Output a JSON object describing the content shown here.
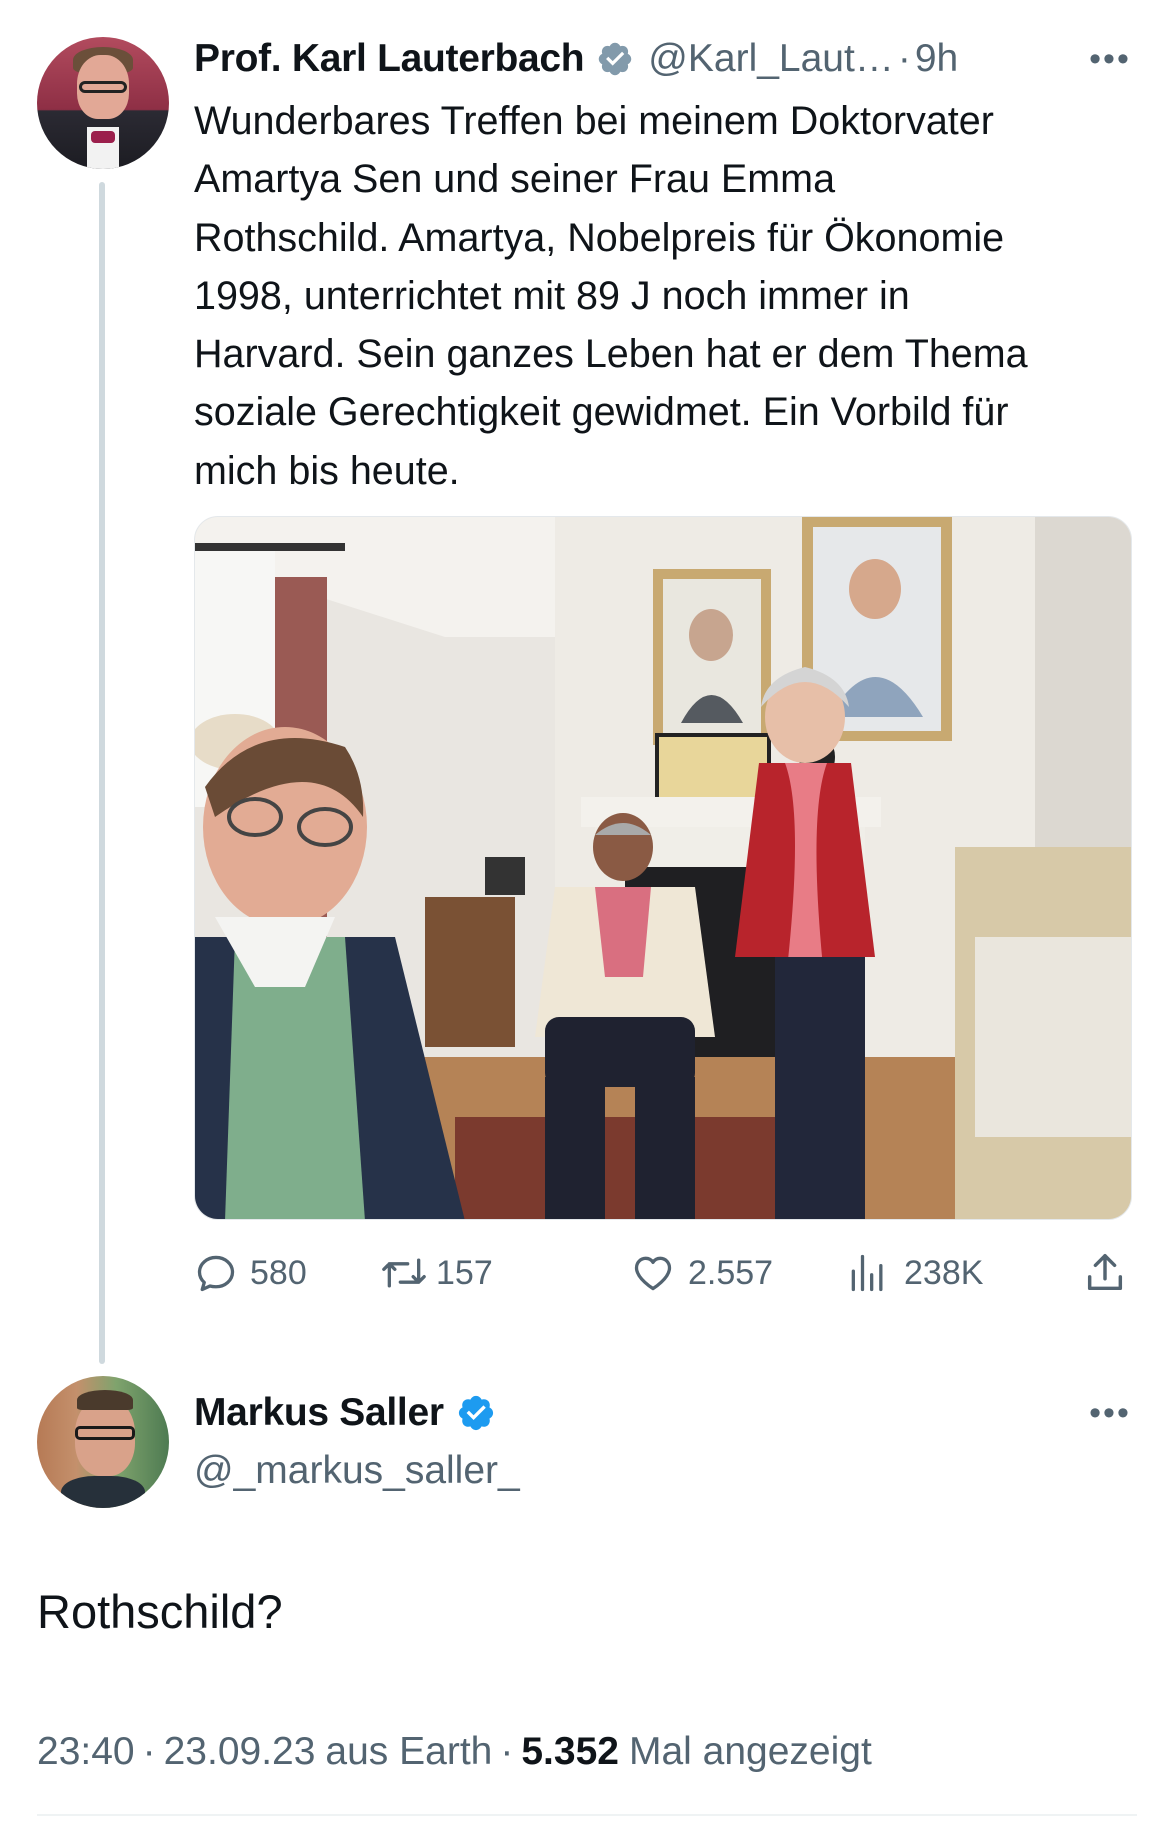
{
  "tweet": {
    "author_name": "Prof. Karl Lauterbach",
    "author_handle": "@Karl_Laut…",
    "time_separator": "·",
    "time_ago": "9h",
    "more_label": "•••",
    "text": "Wunderbares Treffen bei meinem Doktorvater\nAmartya Sen und seiner Frau Emma\nRothschild. Amartya, Nobelpreis für Ökonomie\n1998, unterrichtet mit 89 J noch immer in\nHarvard. Sein ganzes Leben hat er dem Thema\nsoziale Gerechtigkeit gewidmet. Ein Vorbild für\nmich bis heute.",
    "actions": {
      "replies": "580",
      "retweets": "157",
      "likes": "2.557",
      "views": "238K"
    }
  },
  "reply": {
    "author_name": "Markus Saller",
    "author_handle": "@_markus_saller_",
    "more_label": "•••",
    "text": "Rothschild?",
    "meta": {
      "time": "23:40",
      "dot1": "·",
      "date": "23.09.23",
      "source": "aus Earth",
      "dot2": "·",
      "views_count": "5.352",
      "views_label": "Mal angezeigt"
    }
  },
  "colors": {
    "text_primary": "#0f1419",
    "text_secondary": "#536471",
    "verified_blue": "#1d9bf0",
    "verified_grey": "#829aab",
    "thread_line": "#cfd9de"
  },
  "icons": {
    "reply": "speech-bubble-icon",
    "retweet": "retweet-arrows-icon",
    "like": "heart-icon",
    "views": "bar-chart-icon",
    "share": "share-upload-icon"
  }
}
